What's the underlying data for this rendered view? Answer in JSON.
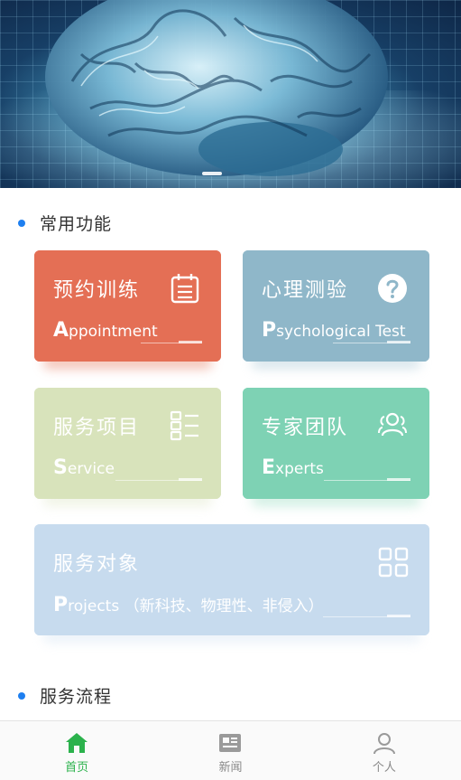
{
  "banner": {
    "image": "brain-illustration",
    "indicator_count": 1
  },
  "sections": {
    "common_title": "常用功能",
    "process_title": "服务流程"
  },
  "cards": {
    "appointment": {
      "title": "预约训练",
      "en_cap": "A",
      "en_rest": "ppointment",
      "icon": "calendar-icon",
      "color": "#e46f55"
    },
    "psychological": {
      "title": "心理测验",
      "en_cap": "P",
      "en_rest": "sychological Test",
      "icon": "question-icon",
      "color": "#8fb7c9"
    },
    "service": {
      "title": "服务项目",
      "en_cap": "S",
      "en_rest": "ervice",
      "icon": "list-icon",
      "color": "#d8e3bb"
    },
    "experts": {
      "title": "专家团队",
      "en_cap": "E",
      "en_rest": "xperts",
      "icon": "team-icon",
      "color": "#7ed2b4"
    },
    "projects": {
      "title": "服务对象",
      "en_cap": "P",
      "en_rest": "rojects （新科技、物理性、非侵入）",
      "icon": "grid-icon",
      "color": "#c7dbee"
    }
  },
  "tabbar": {
    "items": [
      {
        "label": "首页",
        "icon": "home-icon",
        "active": true
      },
      {
        "label": "新闻",
        "icon": "news-icon",
        "active": false
      },
      {
        "label": "个人",
        "icon": "user-icon",
        "active": false
      }
    ],
    "active_color": "#2bb24c"
  }
}
